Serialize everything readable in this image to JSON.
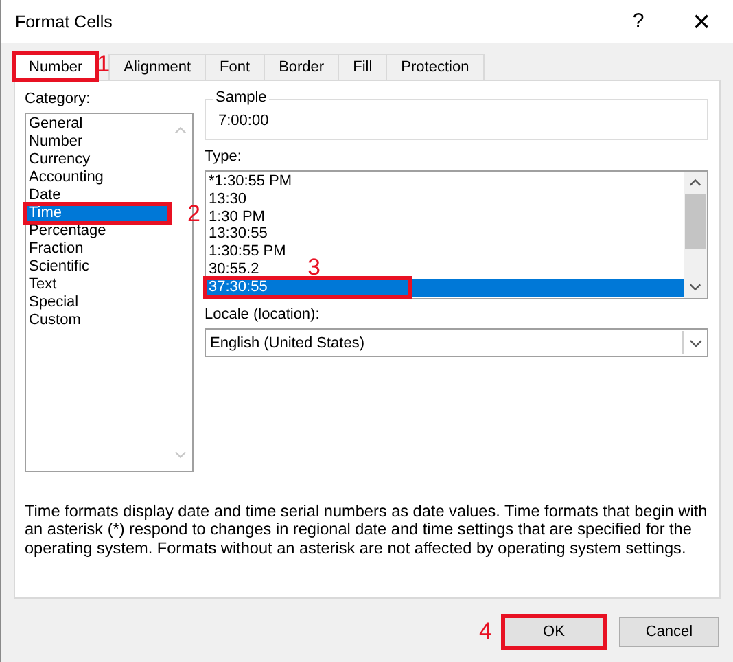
{
  "window": {
    "title": "Format Cells",
    "help": "?",
    "close": "×"
  },
  "tabs": [
    {
      "label": "Number",
      "selected": true,
      "callout": "1"
    },
    {
      "label": "Alignment",
      "selected": false
    },
    {
      "label": "Font",
      "selected": false
    },
    {
      "label": "Border",
      "selected": false
    },
    {
      "label": "Fill",
      "selected": false
    },
    {
      "label": "Protection",
      "selected": false
    }
  ],
  "category": {
    "label": "Category:",
    "items": [
      {
        "label": "General",
        "selected": false
      },
      {
        "label": "Number",
        "selected": false
      },
      {
        "label": "Currency",
        "selected": false
      },
      {
        "label": "Accounting",
        "selected": false
      },
      {
        "label": "Date",
        "selected": false
      },
      {
        "label": "Time",
        "selected": true,
        "callout": "2"
      },
      {
        "label": "Percentage",
        "selected": false
      },
      {
        "label": "Fraction",
        "selected": false
      },
      {
        "label": "Scientific",
        "selected": false
      },
      {
        "label": "Text",
        "selected": false
      },
      {
        "label": "Special",
        "selected": false
      },
      {
        "label": "Custom",
        "selected": false
      }
    ]
  },
  "sample": {
    "label": "Sample",
    "value": "7:00:00"
  },
  "type": {
    "label": "Type:",
    "items": [
      {
        "label": "*1:30:55 PM",
        "selected": false
      },
      {
        "label": "13:30",
        "selected": false
      },
      {
        "label": "1:30 PM",
        "selected": false
      },
      {
        "label": "13:30:55",
        "selected": false
      },
      {
        "label": "1:30:55 PM",
        "selected": false
      },
      {
        "label": "30:55.2",
        "selected": false
      },
      {
        "label": "37:30:55",
        "selected": true,
        "callout": "3"
      }
    ]
  },
  "locale": {
    "label": "Locale (location):",
    "value": "English (United States)"
  },
  "description": "Time formats display date and time serial numbers as date values.  Time formats that begin with an asterisk (*) respond to changes in regional date and time settings that are specified for the operating system. Formats without an asterisk are not affected by operating system settings.",
  "buttons": [
    {
      "label": "OK",
      "callout": "4"
    },
    {
      "label": "Cancel"
    }
  ]
}
